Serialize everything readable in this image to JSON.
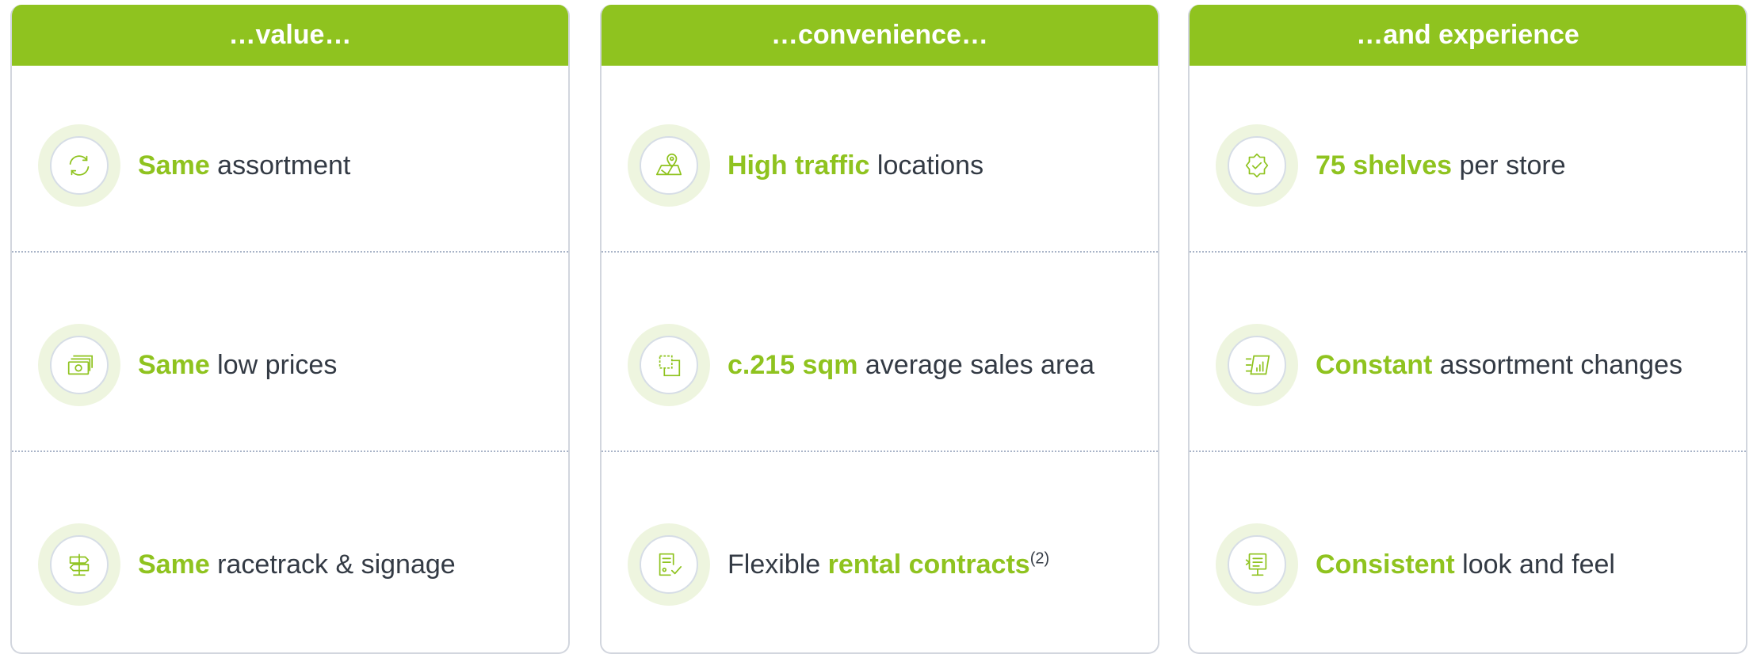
{
  "columns": [
    {
      "header": "…value…",
      "rows": [
        {
          "icon": "refresh-icon",
          "highlight": "Same",
          "text": " assortment"
        },
        {
          "icon": "cash-icon",
          "highlight": "Same",
          "text": " low prices"
        },
        {
          "icon": "signpost-icon",
          "highlight": "Same",
          "text": " racetrack & signage"
        }
      ]
    },
    {
      "header": "…convenience…",
      "rows": [
        {
          "icon": "map-pin-icon",
          "highlight": "High traffic",
          "text": " locations"
        },
        {
          "icon": "area-icon",
          "highlight": "c.215 sqm",
          "text": " average sales area"
        },
        {
          "icon": "contract-icon",
          "prefix": "Flexible ",
          "highlight": "rental contracts",
          "sup": "(2)"
        }
      ]
    },
    {
      "header": "…and experience",
      "rows": [
        {
          "icon": "badge-check-icon",
          "highlight": "75 shelves",
          "text": " per store"
        },
        {
          "icon": "shelf-list-icon",
          "highlight": "Constant",
          "text": " assortment changes"
        },
        {
          "icon": "display-stand-icon",
          "highlight": "Consistent",
          "text": " look and feel"
        }
      ]
    }
  ],
  "colors": {
    "accent": "#8fc31f",
    "text": "#333a44",
    "border": "#d2d6de"
  }
}
